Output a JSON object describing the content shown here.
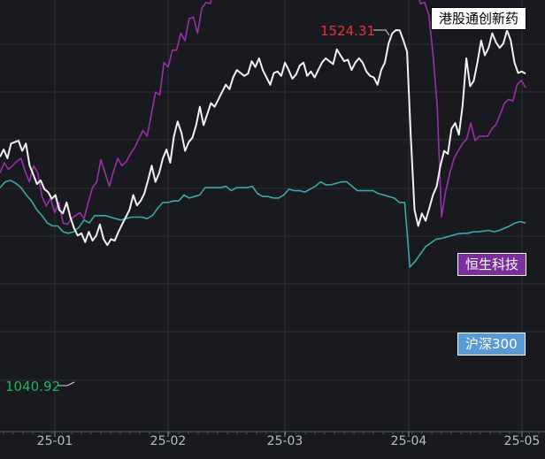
{
  "chart_data": {
    "type": "line",
    "x_ticks": [
      "25-01",
      "25-02",
      "25-03",
      "25-04",
      "25-05"
    ],
    "series": [
      {
        "name": "港股通创新药",
        "color": "#f2f2f2",
        "values": [
          1352,
          1362,
          1350,
          1370,
          1372,
          1374,
          1360,
          1370,
          1340,
          1328,
          1315,
          1320,
          1308,
          1304,
          1295,
          1300,
          1280,
          1275,
          1290,
          1270,
          1255,
          1245,
          1248,
          1236,
          1250,
          1238,
          1245,
          1260,
          1240,
          1232,
          1240,
          1238,
          1250,
          1260,
          1270,
          1280,
          1300,
          1286,
          1292,
          1302,
          1320,
          1340,
          1318,
          1330,
          1350,
          1362,
          1344,
          1380,
          1400,
          1385,
          1360,
          1372,
          1378,
          1395,
          1420,
          1395,
          1410,
          1425,
          1420,
          1430,
          1440,
          1450,
          1444,
          1460,
          1470,
          1466,
          1462,
          1465,
          1482,
          1474,
          1486,
          1470,
          1460,
          1450,
          1466,
          1468,
          1462,
          1480,
          1470,
          1458,
          1464,
          1476,
          1480,
          1462,
          1468,
          1460,
          1470,
          1480,
          1486,
          1482,
          1478,
          1498,
          1490,
          1482,
          1484,
          1470,
          1480,
          1486,
          1480,
          1468,
          1462,
          1460,
          1450,
          1470,
          1480,
          1506,
          1520,
          1524.31,
          1524,
          1510,
          1495,
          1380,
          1280,
          1258,
          1275,
          1265,
          1282,
          1300,
          1312,
          1340,
          1360,
          1356,
          1390,
          1398,
          1382,
          1422,
          1486,
          1448,
          1455,
          1480,
          1510,
          1490,
          1500,
          1520,
          1508,
          1500,
          1506,
          1524,
          1510,
          1480,
          1466,
          1468,
          1465
        ]
      },
      {
        "name": "恒生科技",
        "color": "#9a2fa6",
        "values": [
          1330,
          1344,
          1335,
          1340,
          1346,
          1350,
          1332,
          1318,
          1340,
          1330,
          1298,
          1285,
          1296,
          1276,
          1290,
          1262,
          1260,
          1268,
          1272,
          1276,
          1268,
          1290,
          1310,
          1318,
          1348,
          1330,
          1312,
          1332,
          1350,
          1340,
          1345,
          1356,
          1364,
          1376,
          1388,
          1380,
          1410,
          1440,
          1436,
          1480,
          1474,
          1497,
          1497,
          1520,
          1510,
          1540,
          1542,
          1520,
          1554,
          1562,
          1560,
          1582,
          1608,
          1622,
          1620,
          1604,
          1644,
          1642,
          1652,
          1640,
          1634,
          1660,
          1674,
          1672,
          1684,
          1690,
          1655,
          1660,
          1654,
          1678,
          1698,
          1715,
          1706,
          1690,
          1712,
          1700,
          1696,
          1676,
          1688,
          1712,
          1716,
          1710,
          1702,
          1692,
          1700,
          1715,
          1722,
          1714,
          1692,
          1700,
          1716,
          1690,
          1686,
          1664,
          1646,
          1646,
          1652,
          1650,
          1600,
          1588,
          1560,
          1562,
          1545,
          1490,
          1420,
          1270,
          1305,
          1330,
          1350,
          1360,
          1370,
          1376,
          1398,
          1374,
          1380,
          1380,
          1380,
          1390,
          1396,
          1410,
          1425,
          1430,
          1428,
          1450,
          1456,
          1446
        ]
      },
      {
        "name": "沪深300",
        "color": "#3aa8a8",
        "values": [
          1310,
          1318,
          1320,
          1316,
          1310,
          1300,
          1292,
          1280,
          1272,
          1262,
          1258,
          1258,
          1250,
          1248,
          1250,
          1256,
          1266,
          1262,
          1272,
          1272,
          1272,
          1270,
          1268,
          1266,
          1268,
          1270,
          1270,
          1270,
          1268,
          1272,
          1282,
          1290,
          1290,
          1292,
          1292,
          1300,
          1296,
          1298,
          1300,
          1310,
          1310,
          1310,
          1310,
          1312,
          1306,
          1310,
          1310,
          1310,
          1312,
          1302,
          1298,
          1298,
          1296,
          1296,
          1300,
          1308,
          1306,
          1306,
          1304,
          1308,
          1312,
          1318,
          1314,
          1314,
          1316,
          1318,
          1318,
          1312,
          1306,
          1306,
          1306,
          1306,
          1302,
          1300,
          1298,
          1296,
          1290,
          1290,
          1202,
          1210,
          1220,
          1230,
          1235,
          1240,
          1241,
          1243,
          1245,
          1247,
          1248,
          1248,
          1250,
          1250,
          1251,
          1252,
          1250,
          1252,
          1255,
          1258,
          1262,
          1264,
          1262
        ]
      }
    ],
    "annotations": {
      "max_label": "1524.31",
      "min_label": "1040.92"
    },
    "grid": true,
    "legend_position": "right"
  }
}
